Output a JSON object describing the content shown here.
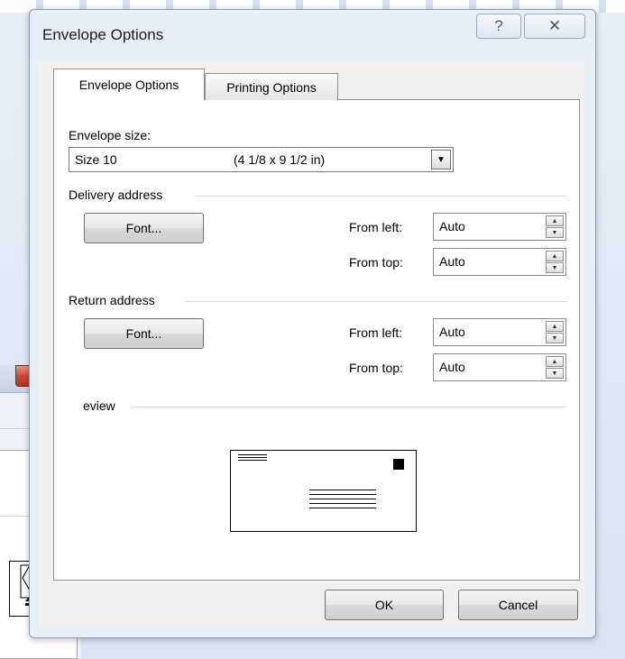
{
  "dialog": {
    "title": "Envelope Options",
    "help_glyph": "?",
    "close_glyph": "✕"
  },
  "tabs": [
    {
      "label": "Envelope Options",
      "active": true
    },
    {
      "label": "Printing Options",
      "active": false
    }
  ],
  "envelope_size": {
    "label": "Envelope size:",
    "selected_name": "Size 10",
    "selected_dimensions": "(4 1/8 x 9 1/2 in)"
  },
  "delivery_address": {
    "group_label": "Delivery address",
    "font_button": "Font...",
    "from_left_label": "From left:",
    "from_left_value": "Auto",
    "from_top_label": "From top:",
    "from_top_value": "Auto"
  },
  "return_address": {
    "group_label": "Return address",
    "font_button": "Font...",
    "from_left_label": "From left:",
    "from_left_value": "Auto",
    "from_top_label": "From top:",
    "from_top_value": "Auto"
  },
  "preview": {
    "group_label": "eview"
  },
  "footer": {
    "ok_label": "OK",
    "cancel_label": "Cancel"
  },
  "background_window": {
    "close_glyph": "X"
  },
  "colors": {
    "close_red": "#c74c37",
    "panel_white": "#ffffff",
    "dialog_frame": "#e8eef6"
  }
}
